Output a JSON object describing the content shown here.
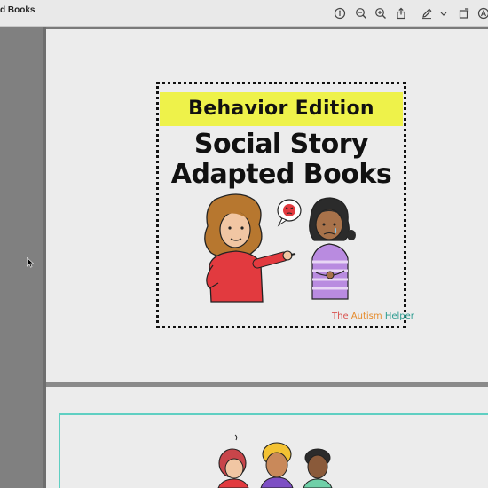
{
  "window": {
    "title": "d Books"
  },
  "toolbar": {
    "icons": [
      "info-icon",
      "zoom-out-icon",
      "zoom-in-icon",
      "share-icon",
      "markup-pen-icon",
      "chevron-down-icon",
      "rotate-icon",
      "annotate-icon"
    ]
  },
  "cover": {
    "banner": "Behavior Edition",
    "title_line1": "Social Story",
    "title_line2": "Adapted Books",
    "brand": {
      "word1": "The",
      "word2": "Autism",
      "word3": "Helper"
    },
    "colors": {
      "banner": "#eef24a",
      "border": "#111111",
      "accent_teal": "#5fcfc2"
    }
  }
}
